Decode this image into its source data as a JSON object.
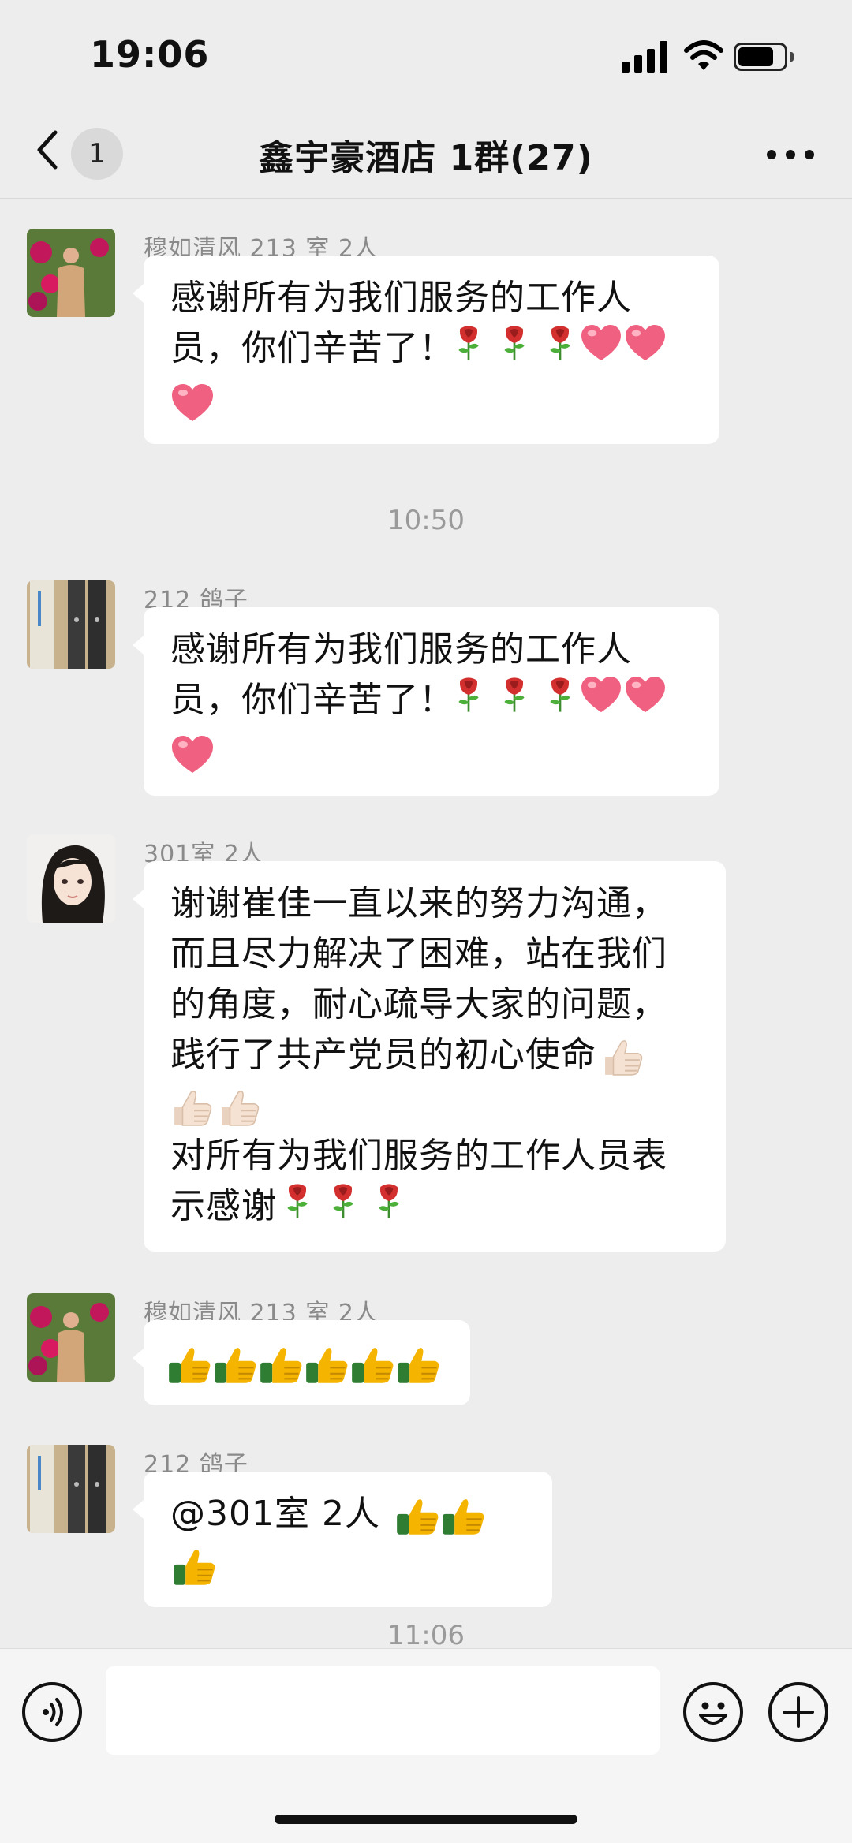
{
  "status_bar": {
    "time": "19:06"
  },
  "header": {
    "back_count": "1",
    "title": "鑫宇豪酒店 1群(27)"
  },
  "messages": [
    {
      "sender": "穆如清风 213 室 2人",
      "lines": [
        "感谢所有为我们服务的工作人",
        "员，你们辛苦了！"
      ]
    },
    {
      "sender": "212 鸽子",
      "lines": [
        "感谢所有为我们服务的工作人",
        "员，你们辛苦了！"
      ]
    },
    {
      "sender": "301室 2人",
      "lines": [
        "谢谢崔佳一直以来的努力沟通，",
        "而且尽力解决了困难，站在我们",
        "的角度，耐心疏导大家的问题，",
        "践行了共产党员的初心使命",
        "",
        "对所有为我们服务的工作人员表",
        "示感谢"
      ]
    },
    {
      "sender": "穆如清风 213 室 2人",
      "lines": [
        ""
      ]
    },
    {
      "sender": "212 鸽子",
      "lines": [
        "@301室 2人 "
      ]
    }
  ],
  "timestamps": [
    "10:50",
    "11:06"
  ],
  "emoji": {
    "rose": "rose-icon",
    "heart": "heart-icon",
    "thumbs_up": "thumbs-up-icon"
  },
  "colors": {
    "background": "#ededed",
    "bubble": "#ffffff",
    "sender": "#8a8a8a",
    "timestamp": "#9a9a9a"
  }
}
